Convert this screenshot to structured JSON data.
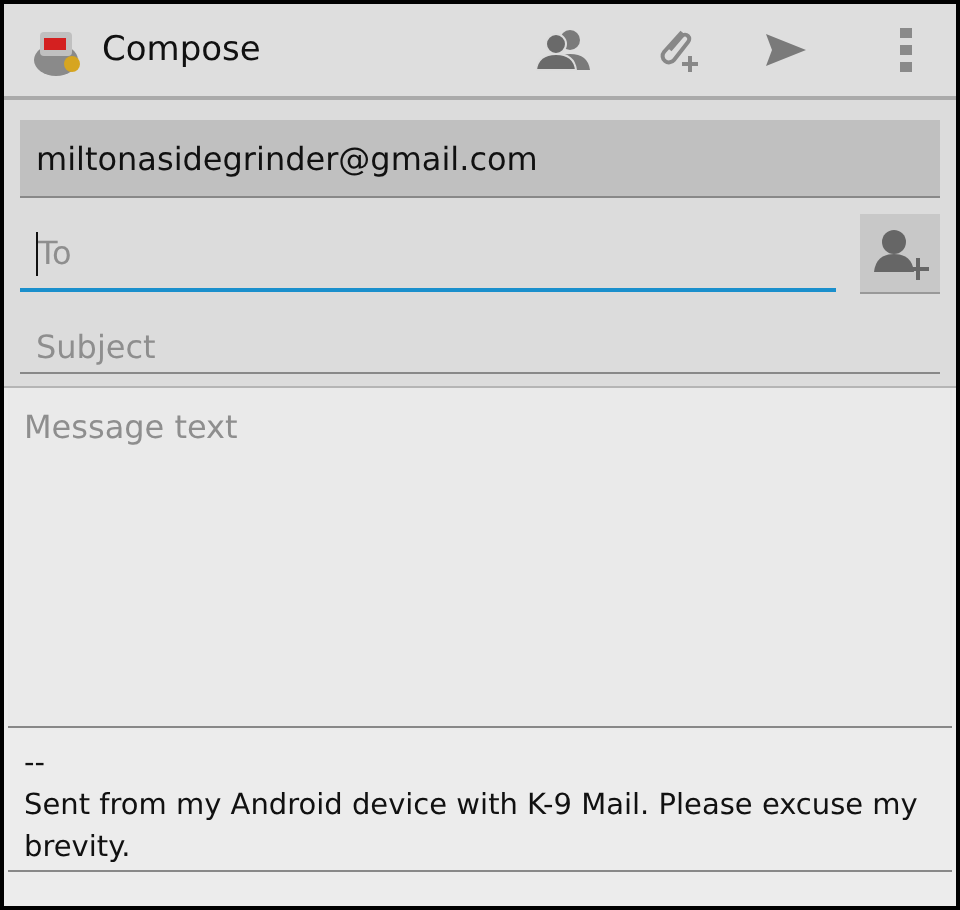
{
  "action_bar": {
    "title": "Compose"
  },
  "from": {
    "value": "miltonasidegrinder@gmail.com"
  },
  "to": {
    "placeholder": "To",
    "focused": true
  },
  "subject": {
    "placeholder": "Subject"
  },
  "message": {
    "placeholder": "Message text"
  },
  "signature": {
    "separator": "--",
    "text": "Sent from my Android device with K-9 Mail. Please excuse my brevity."
  }
}
